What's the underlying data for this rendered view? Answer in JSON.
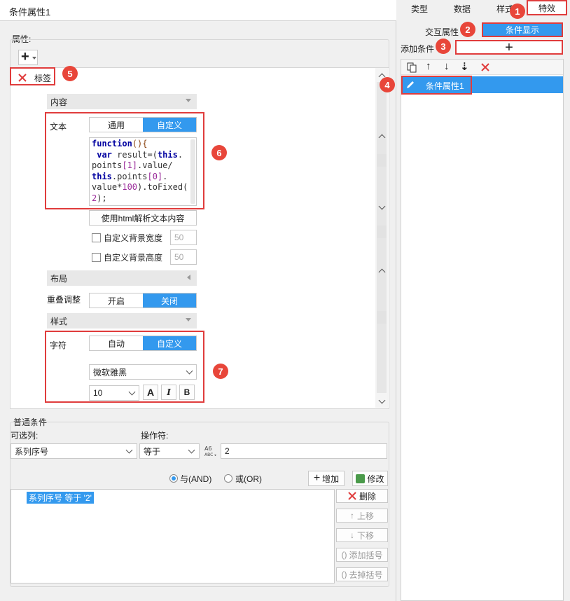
{
  "left": {
    "title": "条件属性1",
    "properties_label": "属性:",
    "add_icon_glyph": "+",
    "tag_label": "标签",
    "content": {
      "section": "内容",
      "text_label": "文本",
      "tabs": [
        "通用",
        "自定义"
      ],
      "code_lines": [
        [
          {
            "t": "function",
            "c": "kw"
          },
          {
            "t": "(){",
            "c": "op"
          }
        ],
        [
          {
            "t": " ",
            "c": ""
          },
          {
            "t": "var",
            "c": "kw"
          },
          {
            "t": " result=(",
            "c": ""
          },
          {
            "t": "this",
            "c": "kw"
          },
          {
            "t": ".",
            "c": ""
          }
        ],
        [
          {
            "t": "points",
            "c": ""
          },
          {
            "t": "[1]",
            "c": "num"
          },
          {
            "t": ".value/",
            "c": ""
          }
        ],
        [
          {
            "t": "this",
            "c": "kw"
          },
          {
            "t": ".points",
            "c": ""
          },
          {
            "t": "[0]",
            "c": "num"
          },
          {
            "t": ".",
            "c": ""
          }
        ],
        [
          {
            "t": "value*",
            "c": ""
          },
          {
            "t": "100",
            "c": "num"
          },
          {
            "t": ").toFixed(",
            "c": ""
          }
        ],
        [
          {
            "t": "2",
            "c": "num"
          },
          {
            "t": ");",
            "c": ""
          }
        ]
      ],
      "html_parse_btn": "使用html解析文本内容",
      "custom_bg_width": "自定义背景宽度",
      "custom_bg_height": "自定义背景高度",
      "bg_width_value": "50",
      "bg_height_value": "50"
    },
    "layout": {
      "section": "布局",
      "overlap_label": "重叠调整",
      "tabs": [
        "开启",
        "关闭"
      ]
    },
    "style": {
      "section": "样式",
      "char_label": "字符",
      "tabs": [
        "自动",
        "自定义"
      ],
      "font_family": "微软雅黑",
      "font_size": "10",
      "bold_glyph": "B",
      "italic_glyph": "I",
      "font_a_glyph": "A"
    },
    "common_condition": {
      "label": "普通条件",
      "optional_col_label": "可选列:",
      "operator_label": "操作符:",
      "column_value": "系列序号",
      "operator_value": "等于",
      "value": "2",
      "and_label": "与(AND)",
      "or_label": "或(OR)",
      "add_btn": "增加",
      "modify_btn": "修改",
      "condition_item": "系列序号 等于 '2'",
      "delete_btn": "删除",
      "move_up_btn": "上移",
      "move_down_btn": "下移",
      "add_bracket_btn": "添加括号",
      "remove_bracket_btn": "去掉括号"
    }
  },
  "right": {
    "tabs": [
      "类型",
      "数据",
      "样式",
      "特效"
    ],
    "active_tab": "特效",
    "interaction_label": "交互属性",
    "condition_display_btn": "条件显示",
    "add_condition_label": "添加条件",
    "add_condition_glyph": "+",
    "list_item": "条件属性1"
  },
  "badges": [
    "1",
    "2",
    "3",
    "4",
    "5",
    "6",
    "7"
  ],
  "colors": {
    "accent": "#3399ee",
    "annotation_red": "#e03c3c"
  }
}
